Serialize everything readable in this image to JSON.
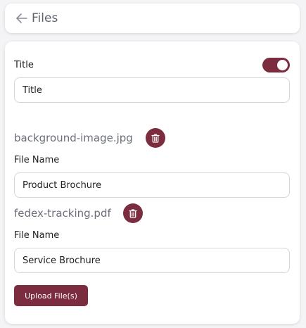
{
  "header": {
    "back_icon": "arrow-left-icon",
    "title": "Files"
  },
  "form": {
    "title_label": "Title",
    "title_toggle_on": true,
    "title_value": "Title",
    "files": [
      {
        "file_name": "background-image.jpg",
        "delete_icon": "trash-icon",
        "name_label": "File Name",
        "name_value": "Product Brochure"
      },
      {
        "file_name": "fedex-tracking.pdf",
        "delete_icon": "trash-icon",
        "name_label": "File Name",
        "name_value": "Service Brochure"
      }
    ],
    "upload_label": "Upload File(s)"
  },
  "colors": {
    "accent": "#7b2c3f",
    "background": "#f4f4f6",
    "card": "#ffffff",
    "muted_text": "#6b6f7a"
  }
}
